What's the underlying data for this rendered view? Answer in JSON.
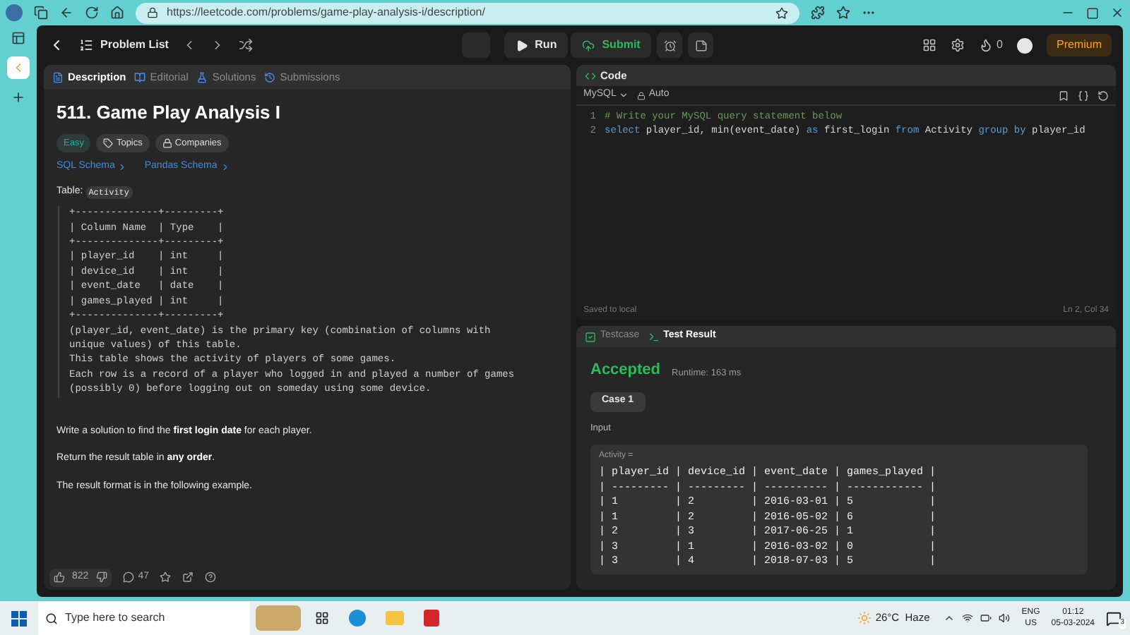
{
  "browser": {
    "url": "https://leetcode.com/problems/game-play-analysis-i/description/"
  },
  "topbar": {
    "problem_list": "Problem List",
    "run": "Run",
    "submit": "Submit",
    "coins": "0",
    "premium": "Premium"
  },
  "left_tabs": [
    {
      "label": "Description",
      "selected": true
    },
    {
      "label": "Editorial",
      "selected": false
    },
    {
      "label": "Solutions",
      "selected": false
    },
    {
      "label": "Submissions",
      "selected": false
    }
  ],
  "problem": {
    "title": "511. Game Play Analysis I",
    "difficulty": "Easy",
    "tags": [
      "Topics",
      "Companies"
    ],
    "links": [
      "SQL Schema",
      "Pandas Schema"
    ],
    "table_label": "Table:",
    "table_name": "Activity",
    "schema_lines": [
      "+--------------+---------+",
      "| Column Name  | Type    |",
      "+--------------+---------+",
      "| player_id    | int     |",
      "| device_id    | int     |",
      "| event_date   | date    |",
      "| games_played | int     |",
      "+--------------+---------+",
      "(player_id, event_date) is the primary key (combination of columns with",
      "unique values) of this table.",
      "This table shows the activity of players of some games.",
      "Each row is a record of a player who logged in and played a number of games",
      "(possibly 0) before logging out on someday using some device."
    ],
    "paragraphs": [
      "Write a solution to find the **first login date** for each player.",
      "Return the result table in **any order**.",
      "The result format is in the following example."
    ]
  },
  "footer": {
    "likes": "822",
    "comments": "47"
  },
  "code": {
    "title": "Code",
    "language": "MySQL",
    "mode": "Auto",
    "lines": [
      {
        "number": "1",
        "tokens": [
          {
            "kind": "comment",
            "text": "# Write your MySQL query statement below"
          }
        ]
      },
      {
        "number": "2",
        "tokens": [
          {
            "kind": "keyword",
            "text": "select"
          },
          {
            "kind": "plain",
            "text": " player_id, min(event_date) "
          },
          {
            "kind": "keyword",
            "text": "as"
          },
          {
            "kind": "plain",
            "text": " first_login "
          },
          {
            "kind": "keyword",
            "text": "from"
          },
          {
            "kind": "plain",
            "text": " Activity "
          },
          {
            "kind": "keyword",
            "text": "group by"
          },
          {
            "kind": "plain",
            "text": " player_id"
          }
        ]
      }
    ],
    "status": "Saved to local",
    "cursor": "Ln 2, Col 34"
  },
  "result": {
    "tabs": [
      {
        "label": "Testcase",
        "selected": false
      },
      {
        "label": "Test Result",
        "selected": true
      }
    ],
    "verdict": "Accepted",
    "runtime": "Runtime: 163 ms",
    "case": "Case 1",
    "input_label": "Input",
    "variable": "Activity =",
    "table_lines": [
      "| player_id | device_id | event_date | games_played |",
      "| --------- | --------- | ---------- | ------------ |",
      "| 1         | 2         | 2016-03-01 | 5            |",
      "| 1         | 2         | 2016-05-02 | 6            |",
      "| 2         | 3         | 2017-06-25 | 1            |",
      "| 3         | 1         | 2016-03-02 | 0            |",
      "| 3         | 4         | 2018-07-03 | 5            |"
    ]
  },
  "taskbar": {
    "search_placeholder": "Type here to search",
    "weather": "26°C  Haze",
    "language": "ENG",
    "region": "US",
    "time": "01:12",
    "date": "05-03-2024",
    "notifications": "3"
  }
}
